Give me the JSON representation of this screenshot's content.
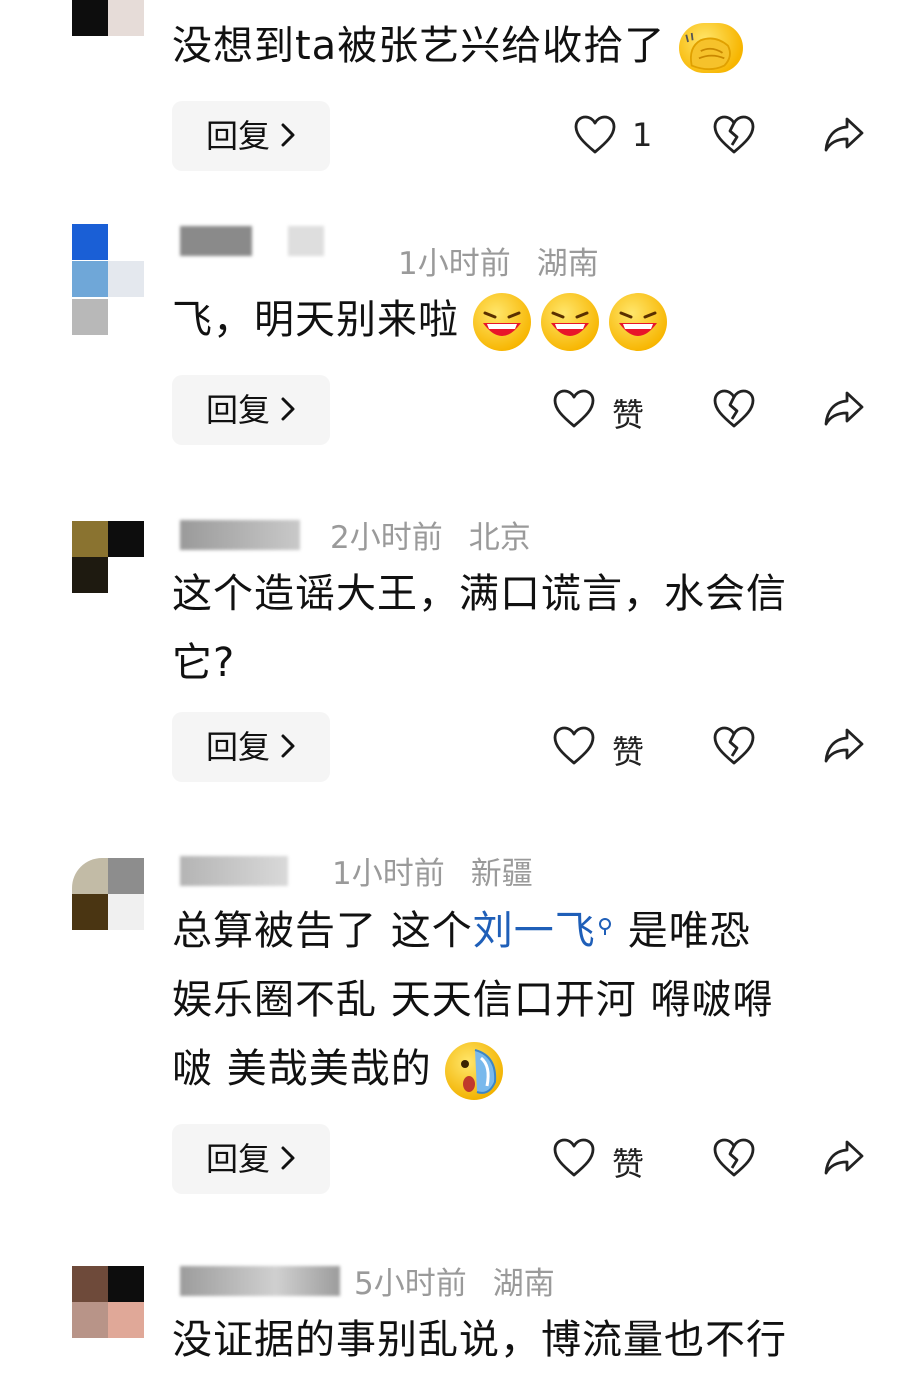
{
  "comments": [
    {
      "text": "没想到ta被张艺兴给收拾了",
      "reply_label": "回复",
      "like_count": "1"
    },
    {
      "time": "1小时前",
      "location": "湖南",
      "text": "飞，明天别来啦",
      "reply_label": "回复",
      "like_label": "赞"
    },
    {
      "time": "2小时前",
      "location": "北京",
      "text_line1": "这个造谣大王，满口谎言，水会信",
      "text_line2": "它?",
      "reply_label": "回复",
      "like_label": "赞"
    },
    {
      "time": "1小时前",
      "location": "新疆",
      "text_pre": "总算被告了 这个",
      "mention": "刘一飞",
      "text_post": "是唯恐",
      "text_line2": "娱乐圈不乱 天天信口开河 嘚啵嘚",
      "text_line3": "啵 美哉美哉的",
      "reply_label": "回复",
      "like_label": "赞"
    },
    {
      "time": "5小时前",
      "location": "湖南",
      "text": "没证据的事别乱说，博流量也不行"
    }
  ],
  "colors": {
    "mention": "#1f5fb8",
    "meta": "#9a9a9a",
    "reply_bg": "#f5f5f5"
  },
  "icons": [
    "heart-icon",
    "dislike-heart-icon",
    "share-icon",
    "chevron-right-icon",
    "mention-search-icon"
  ]
}
